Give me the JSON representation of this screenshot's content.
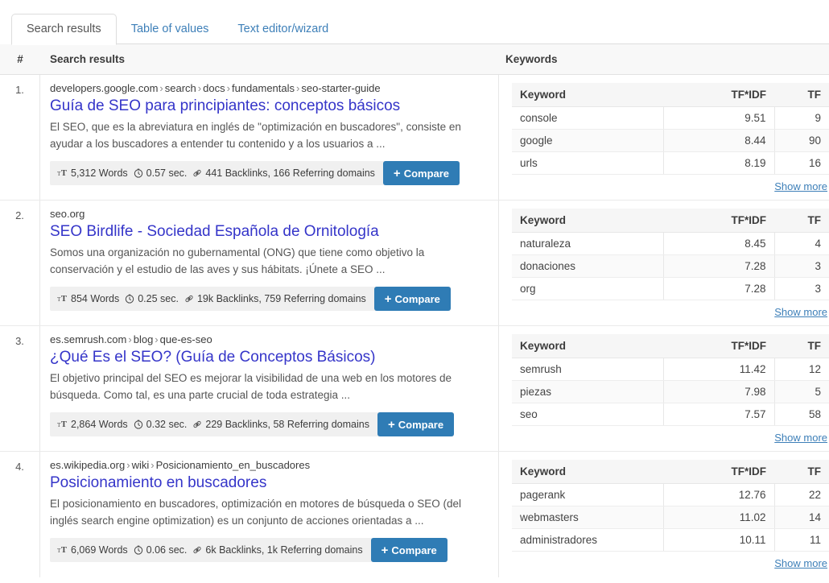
{
  "tabs": [
    {
      "label": "Search results",
      "active": true
    },
    {
      "label": "Table of values",
      "active": false
    },
    {
      "label": "Text editor/wizard",
      "active": false
    }
  ],
  "columns": {
    "hash": "#",
    "search_results": "Search results",
    "keywords": "Keywords"
  },
  "keyword_table_headers": {
    "keyword": "Keyword",
    "tfidf": "TF*IDF",
    "tf": "TF"
  },
  "labels": {
    "compare": "Compare",
    "compare_plus": "+",
    "show_more": "Show more",
    "words_icon": "text-size-icon",
    "time_icon": "stopwatch-icon",
    "link_icon": "link-icon"
  },
  "colors": {
    "accent_blue": "#2f7cb5",
    "link_blue": "#3d7fb8",
    "title_purple": "#3535c9",
    "header_bg": "#f8f8f8",
    "meta_bg": "#f0f0f0"
  },
  "results": [
    {
      "num": "1.",
      "url_domain": "developers.google.com",
      "url_path": [
        "search",
        "docs",
        "fundamentals",
        "seo-starter-guide"
      ],
      "title": "Guía de SEO para principiantes: conceptos básicos",
      "snippet": "El SEO, que es la abreviatura en inglés de \"optimización en buscadores\", consiste en ayudar a los buscadores a entender tu contenido y a los usuarios a ...",
      "words": "5,312 Words",
      "time": "0.57 sec.",
      "backlinks": "441 Backlinks, 166 Referring domains",
      "keywords": [
        {
          "keyword": "console",
          "tfidf": "9.51",
          "tf": "9"
        },
        {
          "keyword": "google",
          "tfidf": "8.44",
          "tf": "90"
        },
        {
          "keyword": "urls",
          "tfidf": "8.19",
          "tf": "16"
        }
      ]
    },
    {
      "num": "2.",
      "url_domain": "seo.org",
      "url_path": [],
      "title": "SEO Birdlife - Sociedad Española de Ornitología",
      "snippet": "Somos una organización no gubernamental (ONG) que tiene como objetivo la conservación y el estudio de las aves y sus hábitats. ¡Únete a SEO ...",
      "words": "854 Words",
      "time": "0.25 sec.",
      "backlinks": "19k Backlinks, 759 Referring domains",
      "keywords": [
        {
          "keyword": "naturaleza",
          "tfidf": "8.45",
          "tf": "4"
        },
        {
          "keyword": "donaciones",
          "tfidf": "7.28",
          "tf": "3"
        },
        {
          "keyword": "org",
          "tfidf": "7.28",
          "tf": "3"
        }
      ]
    },
    {
      "num": "3.",
      "url_domain": "es.semrush.com",
      "url_path": [
        "blog",
        "que-es-seo"
      ],
      "title": "¿Qué Es el SEO? (Guía de Conceptos Básicos)",
      "snippet": "El objetivo principal del SEO es mejorar la visibilidad de una web en los motores de búsqueda. Como tal, es una parte crucial de toda estrategia ...",
      "words": "2,864 Words",
      "time": "0.32 sec.",
      "backlinks": "229 Backlinks, 58 Referring domains",
      "keywords": [
        {
          "keyword": "semrush",
          "tfidf": "11.42",
          "tf": "12"
        },
        {
          "keyword": "piezas",
          "tfidf": "7.98",
          "tf": "5"
        },
        {
          "keyword": "seo",
          "tfidf": "7.57",
          "tf": "58"
        }
      ]
    },
    {
      "num": "4.",
      "url_domain": "es.wikipedia.org",
      "url_path": [
        "wiki",
        "Posicionamiento_en_buscadores"
      ],
      "title": "Posicionamiento en buscadores",
      "snippet": "El posicionamiento en buscadores, optimización en motores de búsqueda o SEO (del inglés search engine optimization) es un conjunto de acciones orientadas a ...",
      "words": "6,069 Words",
      "time": "0.06 sec.",
      "backlinks": "6k Backlinks, 1k Referring domains",
      "keywords": [
        {
          "keyword": "pagerank",
          "tfidf": "12.76",
          "tf": "22"
        },
        {
          "keyword": "webmasters",
          "tfidf": "11.02",
          "tf": "14"
        },
        {
          "keyword": "administradores",
          "tfidf": "10.11",
          "tf": "11"
        }
      ]
    }
  ]
}
